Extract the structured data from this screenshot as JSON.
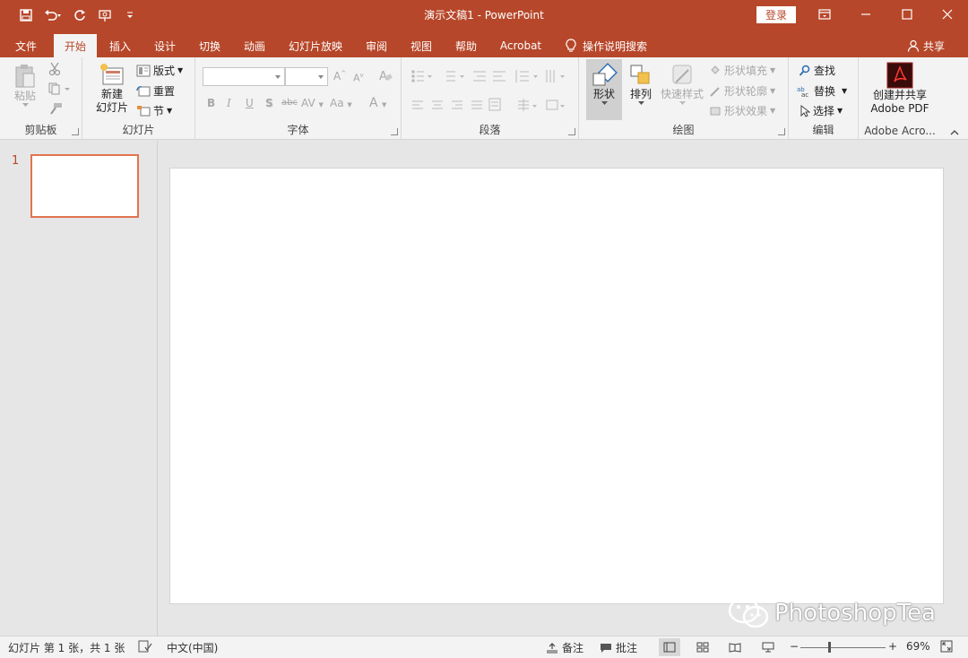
{
  "window": {
    "title": "演示文稿1  -  PowerPoint",
    "login_label": "登录"
  },
  "tabs": [
    {
      "label": "文件"
    },
    {
      "label": "开始"
    },
    {
      "label": "插入"
    },
    {
      "label": "设计"
    },
    {
      "label": "切换"
    },
    {
      "label": "动画"
    },
    {
      "label": "幻灯片放映"
    },
    {
      "label": "审阅"
    },
    {
      "label": "视图"
    },
    {
      "label": "帮助"
    },
    {
      "label": "Acrobat"
    }
  ],
  "tell_me": "操作说明搜索",
  "share_label": "共享",
  "ribbon": {
    "clipboard": {
      "label": "剪贴板",
      "paste": "粘贴"
    },
    "slides": {
      "label": "幻灯片",
      "new_slide_1": "新建",
      "new_slide_2": "幻灯片",
      "layout": "版式",
      "reset": "重置",
      "section": "节"
    },
    "font": {
      "label": "字体",
      "bold": "B",
      "italic": "I",
      "underline": "U",
      "shadow": "S",
      "strike": "abc",
      "spacing": "AV",
      "case": "Aa",
      "color": "A"
    },
    "paragraph": {
      "label": "段落"
    },
    "drawing": {
      "label": "绘图",
      "shapes": "形状",
      "arrange": "排列",
      "quick_styles": "快速样式",
      "shape_fill": "形状填充",
      "shape_outline": "形状轮廓",
      "shape_effects": "形状效果"
    },
    "editing": {
      "label": "编辑",
      "find": "查找",
      "replace": "替换",
      "select": "选择"
    },
    "acrobat": {
      "label": "Adobe Acro...",
      "create_1": "创建并共享",
      "create_2": "Adobe PDF"
    }
  },
  "slides_pane": {
    "slide_number": "1"
  },
  "watermark": "PhotoshopTea",
  "status": {
    "slide_info": "幻灯片 第 1 张，共 1 张",
    "language": "中文(中国)",
    "notes": "备注",
    "comments": "批注",
    "zoom": "69%"
  },
  "colors": {
    "accent": "#b7472a",
    "selection": "#e2734f"
  }
}
